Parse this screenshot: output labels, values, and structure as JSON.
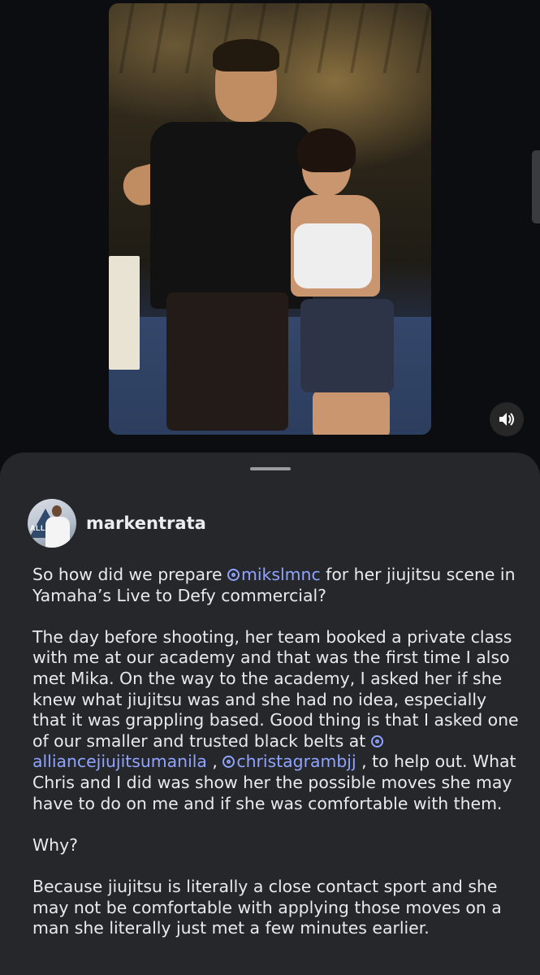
{
  "post": {
    "author": {
      "username": "markentrata",
      "avatar_badge_text": "ALL"
    },
    "media": {
      "sound_icon": "speaker-icon"
    },
    "caption": {
      "p1_pre": "So how did we prepare ",
      "p1_mention": "mikslmnc",
      "p1_post": " for her jiujitsu scene in Yamaha’s Live to Defy commercial?",
      "p2_pre": "The day before shooting, her team booked a private class with me at our academy and that was the first time I also met Mika. On the way to the academy, I asked her if she knew what jiujitsu was and she had no idea, especially that it was grappling based. Good thing is that I asked one of our smaller and trusted black belts at ",
      "p2_mention1": "alliancejiujitsumanila",
      "p2_sep": " , ",
      "p2_mention2": "christagrambjj",
      "p2_post": " , to help out. What Chris and I did was show her the possible moves she may have to do on me and if she was comfortable with them.",
      "p3": "Why?",
      "p4": "Because jiujitsu is literally a close contact sport and she may not be comfortable with applying those moves on a man she literally just met a few minutes earlier."
    }
  },
  "colors": {
    "background": "#0c0d10",
    "sheet": "#26272b",
    "mention": "#8ea4ff",
    "text": "#e9eaec"
  }
}
